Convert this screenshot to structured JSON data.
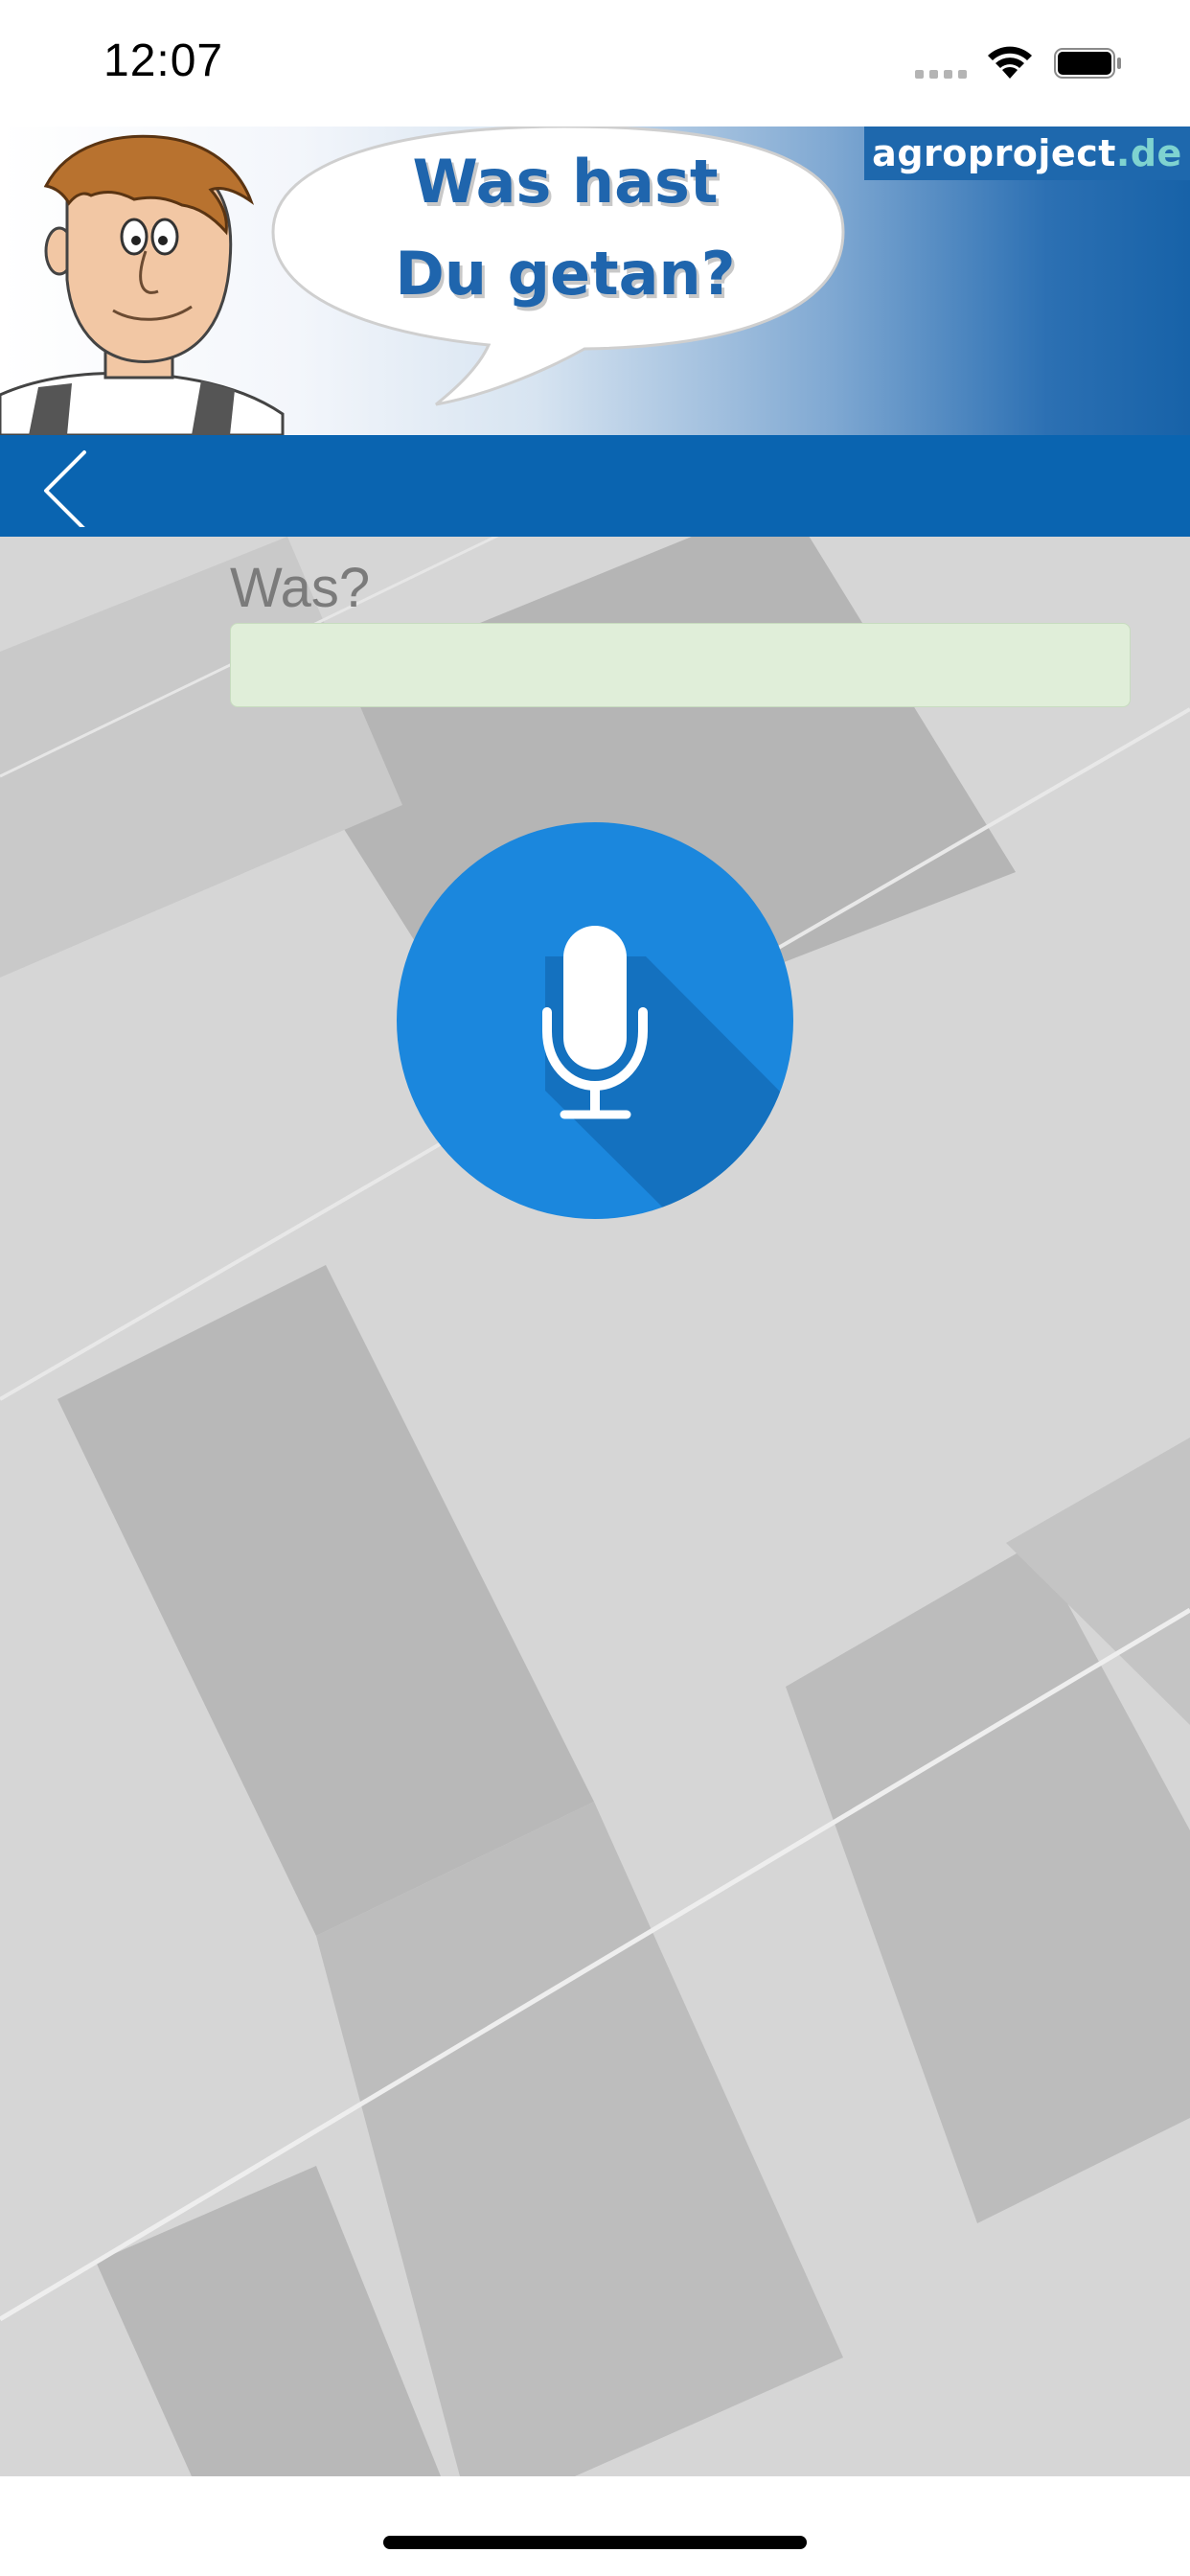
{
  "status_bar": {
    "time": "12:07"
  },
  "banner": {
    "speech_line1": "Was hast",
    "speech_line2": "Du getan?",
    "brand_name": "agroproject",
    "brand_tld": ".de"
  },
  "nav": {
    "back_icon": "chevron-left-icon"
  },
  "form": {
    "label": "Was?",
    "input_value": "",
    "input_placeholder": ""
  },
  "mic": {
    "icon": "microphone-icon",
    "color": "#1b87dd"
  },
  "colors": {
    "nav": "#0a64b0",
    "brand": "#1e68ad",
    "input_bg": "#e0eed9"
  }
}
